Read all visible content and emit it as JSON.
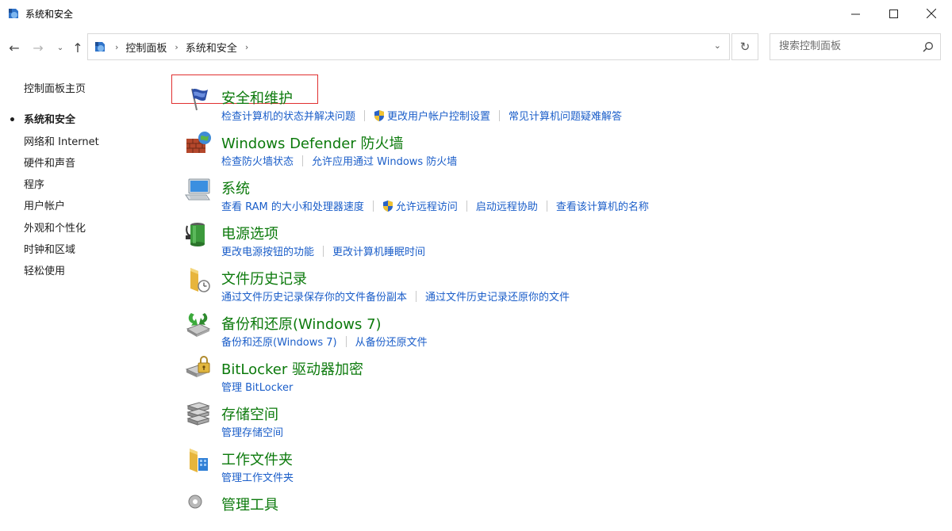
{
  "window": {
    "title": "系统和安全"
  },
  "nav": {
    "breadcrumb": [
      "控制面板",
      "系统和安全"
    ],
    "search_placeholder": "搜索控制面板"
  },
  "sidebar": {
    "home": "控制面板主页",
    "items": [
      {
        "label": "系统和安全",
        "current": true
      },
      {
        "label": "网络和 Internet",
        "current": false
      },
      {
        "label": "硬件和声音",
        "current": false
      },
      {
        "label": "程序",
        "current": false
      },
      {
        "label": "用户帐户",
        "current": false
      },
      {
        "label": "外观和个性化",
        "current": false
      },
      {
        "label": "时钟和区域",
        "current": false
      },
      {
        "label": "轻松使用",
        "current": false
      }
    ]
  },
  "categories": [
    {
      "title": "安全和维护",
      "icon": "flag-icon",
      "links": [
        {
          "label": "检查计算机的状态并解决问题"
        },
        {
          "label": "更改用户帐户控制设置",
          "shield": true
        },
        {
          "label": "常见计算机问题疑难解答"
        }
      ]
    },
    {
      "title": "Windows Defender 防火墙",
      "icon": "firewall-icon",
      "links": [
        {
          "label": "检查防火墙状态"
        },
        {
          "label": "允许应用通过 Windows 防火墙"
        }
      ]
    },
    {
      "title": "系统",
      "icon": "computer-icon",
      "links": [
        {
          "label": "查看 RAM 的大小和处理器速度"
        },
        {
          "label": "允许远程访问",
          "shield": true
        },
        {
          "label": "启动远程协助"
        },
        {
          "label": "查看该计算机的名称"
        }
      ]
    },
    {
      "title": "电源选项",
      "icon": "battery-icon",
      "links": [
        {
          "label": "更改电源按钮的功能"
        },
        {
          "label": "更改计算机睡眠时间"
        }
      ]
    },
    {
      "title": "文件历史记录",
      "icon": "file-history-icon",
      "links": [
        {
          "label": "通过文件历史记录保存你的文件备份副本"
        },
        {
          "label": "通过文件历史记录还原你的文件"
        }
      ]
    },
    {
      "title": "备份和还原(Windows 7)",
      "icon": "backup-icon",
      "links": [
        {
          "label": "备份和还原(Windows 7)"
        },
        {
          "label": "从备份还原文件"
        }
      ]
    },
    {
      "title": "BitLocker 驱动器加密",
      "icon": "bitlocker-icon",
      "links": [
        {
          "label": "管理 BitLocker"
        }
      ]
    },
    {
      "title": "存储空间",
      "icon": "storage-icon",
      "links": [
        {
          "label": "管理存储空间"
        }
      ]
    },
    {
      "title": "工作文件夹",
      "icon": "work-folders-icon",
      "links": [
        {
          "label": "管理工作文件夹"
        }
      ]
    },
    {
      "title": "管理工具",
      "icon": "admin-tools-icon",
      "links": []
    }
  ],
  "colors": {
    "category_title": "#0c7a0c",
    "link": "#1b5ec9",
    "highlight": "#e03030"
  }
}
